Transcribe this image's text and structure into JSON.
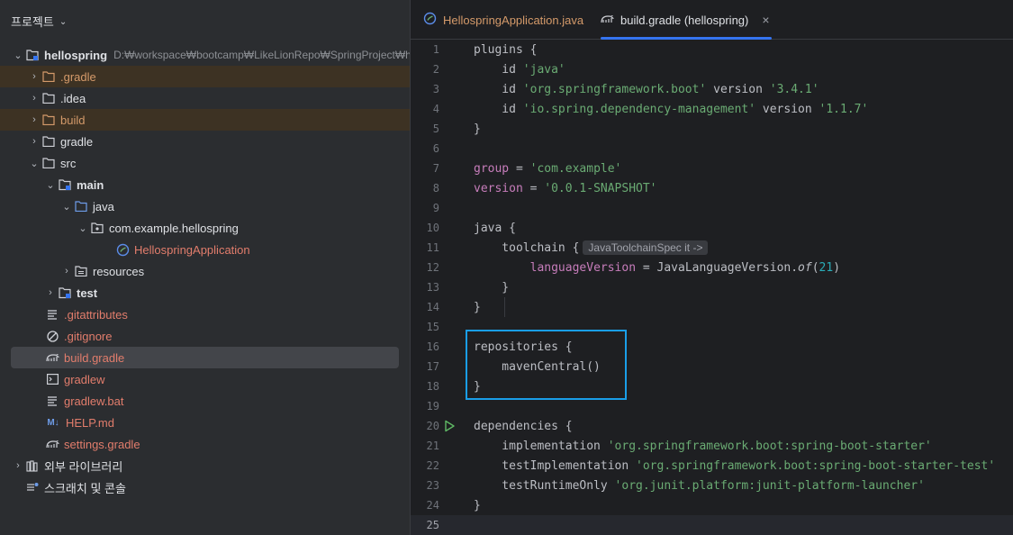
{
  "panel": {
    "title": "프로젝트",
    "root": {
      "label": "hellospring",
      "path": "D:₩workspace₩bootcamp₩LikeLionRepo₩SpringProject₩hello"
    },
    "items": [
      {
        "label": ".gradle"
      },
      {
        "label": ".idea"
      },
      {
        "label": "build"
      },
      {
        "label": "gradle"
      },
      {
        "label": "src"
      },
      {
        "label": "main"
      },
      {
        "label": "java"
      },
      {
        "label": "com.example.hellospring"
      },
      {
        "label": "HellospringApplication"
      },
      {
        "label": "resources"
      },
      {
        "label": "test"
      },
      {
        "label": ".gitattributes"
      },
      {
        "label": ".gitignore"
      },
      {
        "label": "build.gradle"
      },
      {
        "label": "gradlew"
      },
      {
        "label": "gradlew.bat"
      },
      {
        "label": "HELP.md"
      },
      {
        "label": "settings.gradle"
      },
      {
        "label": "외부 라이브러리"
      },
      {
        "label": "스크래치 및 콘솔"
      }
    ]
  },
  "tabs": [
    {
      "label": "HellospringApplication.java"
    },
    {
      "label": "build.gradle (hellospring)"
    }
  ],
  "editor": {
    "line_numbers": [
      "1",
      "2",
      "3",
      "4",
      "5",
      "6",
      "7",
      "8",
      "9",
      "10",
      "11",
      "12",
      "13",
      "14",
      "15",
      "16",
      "17",
      "18",
      "19",
      "20",
      "21",
      "22",
      "23",
      "24",
      "25"
    ],
    "code": {
      "l1": "plugins {",
      "l2a": "    id ",
      "l2b": "'java'",
      "l3a": "    id ",
      "l3b": "'org.springframework.boot'",
      "l3c": " version ",
      "l3d": "'3.4.1'",
      "l4a": "    id ",
      "l4b": "'io.spring.dependency-management'",
      "l4c": " version ",
      "l4d": "'1.1.7'",
      "l5": "}",
      "l7a": "group",
      "l7b": " = ",
      "l7c": "'com.example'",
      "l8a": "version",
      "l8b": " = ",
      "l8c": "'0.0.1-SNAPSHOT'",
      "l10": "java {",
      "l11": "    toolchain {",
      "l11hint": "JavaToolchainSpec it ->",
      "l12a": "        ",
      "l12b": "languageVersion",
      "l12c": " = JavaLanguageVersion.",
      "l12d": "of",
      "l12e": "(",
      "l12f": "21",
      "l12g": ")",
      "l13": "    }",
      "l14": "}",
      "l16": "repositories {",
      "l17": "    mavenCentral()",
      "l18": "}",
      "l20": "dependencies {",
      "l21a": "    implementation ",
      "l21b": "'org.springframework.boot:spring-boot-starter'",
      "l22a": "    testImplementation ",
      "l22b": "'org.springframework.boot:spring-boot-starter-test'",
      "l23a": "    testRuntimeOnly ",
      "l23b": "'org.junit.platform:junit-platform-launcher'",
      "l24": "}"
    }
  },
  "colors": {
    "accent": "#3574f0",
    "highlight_box": "#1a9ee8",
    "string": "#6aab73",
    "property": "#c77dbb",
    "number": "#2aacb8"
  }
}
